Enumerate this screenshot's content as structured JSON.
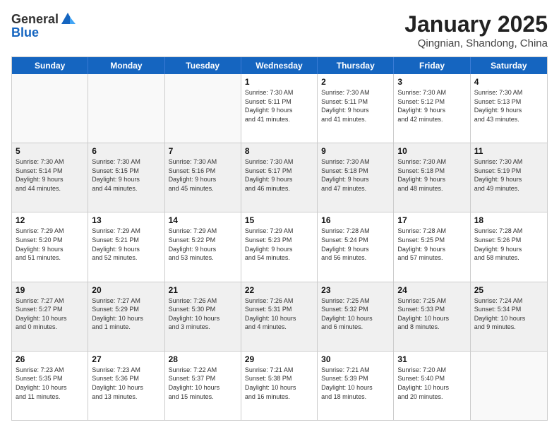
{
  "logo": {
    "general": "General",
    "blue": "Blue"
  },
  "header": {
    "title": "January 2025",
    "subtitle": "Qingnian, Shandong, China"
  },
  "days": [
    "Sunday",
    "Monday",
    "Tuesday",
    "Wednesday",
    "Thursday",
    "Friday",
    "Saturday"
  ],
  "weeks": [
    [
      {
        "day": "",
        "data": ""
      },
      {
        "day": "",
        "data": ""
      },
      {
        "day": "",
        "data": ""
      },
      {
        "day": "1",
        "data": "Sunrise: 7:30 AM\nSunset: 5:11 PM\nDaylight: 9 hours\nand 41 minutes."
      },
      {
        "day": "2",
        "data": "Sunrise: 7:30 AM\nSunset: 5:11 PM\nDaylight: 9 hours\nand 41 minutes."
      },
      {
        "day": "3",
        "data": "Sunrise: 7:30 AM\nSunset: 5:12 PM\nDaylight: 9 hours\nand 42 minutes."
      },
      {
        "day": "4",
        "data": "Sunrise: 7:30 AM\nSunset: 5:13 PM\nDaylight: 9 hours\nand 43 minutes."
      }
    ],
    [
      {
        "day": "5",
        "data": "Sunrise: 7:30 AM\nSunset: 5:14 PM\nDaylight: 9 hours\nand 44 minutes."
      },
      {
        "day": "6",
        "data": "Sunrise: 7:30 AM\nSunset: 5:15 PM\nDaylight: 9 hours\nand 44 minutes."
      },
      {
        "day": "7",
        "data": "Sunrise: 7:30 AM\nSunset: 5:16 PM\nDaylight: 9 hours\nand 45 minutes."
      },
      {
        "day": "8",
        "data": "Sunrise: 7:30 AM\nSunset: 5:17 PM\nDaylight: 9 hours\nand 46 minutes."
      },
      {
        "day": "9",
        "data": "Sunrise: 7:30 AM\nSunset: 5:18 PM\nDaylight: 9 hours\nand 47 minutes."
      },
      {
        "day": "10",
        "data": "Sunrise: 7:30 AM\nSunset: 5:18 PM\nDaylight: 9 hours\nand 48 minutes."
      },
      {
        "day": "11",
        "data": "Sunrise: 7:30 AM\nSunset: 5:19 PM\nDaylight: 9 hours\nand 49 minutes."
      }
    ],
    [
      {
        "day": "12",
        "data": "Sunrise: 7:29 AM\nSunset: 5:20 PM\nDaylight: 9 hours\nand 51 minutes."
      },
      {
        "day": "13",
        "data": "Sunrise: 7:29 AM\nSunset: 5:21 PM\nDaylight: 9 hours\nand 52 minutes."
      },
      {
        "day": "14",
        "data": "Sunrise: 7:29 AM\nSunset: 5:22 PM\nDaylight: 9 hours\nand 53 minutes."
      },
      {
        "day": "15",
        "data": "Sunrise: 7:29 AM\nSunset: 5:23 PM\nDaylight: 9 hours\nand 54 minutes."
      },
      {
        "day": "16",
        "data": "Sunrise: 7:28 AM\nSunset: 5:24 PM\nDaylight: 9 hours\nand 56 minutes."
      },
      {
        "day": "17",
        "data": "Sunrise: 7:28 AM\nSunset: 5:25 PM\nDaylight: 9 hours\nand 57 minutes."
      },
      {
        "day": "18",
        "data": "Sunrise: 7:28 AM\nSunset: 5:26 PM\nDaylight: 9 hours\nand 58 minutes."
      }
    ],
    [
      {
        "day": "19",
        "data": "Sunrise: 7:27 AM\nSunset: 5:27 PM\nDaylight: 10 hours\nand 0 minutes."
      },
      {
        "day": "20",
        "data": "Sunrise: 7:27 AM\nSunset: 5:29 PM\nDaylight: 10 hours\nand 1 minute."
      },
      {
        "day": "21",
        "data": "Sunrise: 7:26 AM\nSunset: 5:30 PM\nDaylight: 10 hours\nand 3 minutes."
      },
      {
        "day": "22",
        "data": "Sunrise: 7:26 AM\nSunset: 5:31 PM\nDaylight: 10 hours\nand 4 minutes."
      },
      {
        "day": "23",
        "data": "Sunrise: 7:25 AM\nSunset: 5:32 PM\nDaylight: 10 hours\nand 6 minutes."
      },
      {
        "day": "24",
        "data": "Sunrise: 7:25 AM\nSunset: 5:33 PM\nDaylight: 10 hours\nand 8 minutes."
      },
      {
        "day": "25",
        "data": "Sunrise: 7:24 AM\nSunset: 5:34 PM\nDaylight: 10 hours\nand 9 minutes."
      }
    ],
    [
      {
        "day": "26",
        "data": "Sunrise: 7:23 AM\nSunset: 5:35 PM\nDaylight: 10 hours\nand 11 minutes."
      },
      {
        "day": "27",
        "data": "Sunrise: 7:23 AM\nSunset: 5:36 PM\nDaylight: 10 hours\nand 13 minutes."
      },
      {
        "day": "28",
        "data": "Sunrise: 7:22 AM\nSunset: 5:37 PM\nDaylight: 10 hours\nand 15 minutes."
      },
      {
        "day": "29",
        "data": "Sunrise: 7:21 AM\nSunset: 5:38 PM\nDaylight: 10 hours\nand 16 minutes."
      },
      {
        "day": "30",
        "data": "Sunrise: 7:21 AM\nSunset: 5:39 PM\nDaylight: 10 hours\nand 18 minutes."
      },
      {
        "day": "31",
        "data": "Sunrise: 7:20 AM\nSunset: 5:40 PM\nDaylight: 10 hours\nand 20 minutes."
      },
      {
        "day": "",
        "data": ""
      }
    ]
  ]
}
